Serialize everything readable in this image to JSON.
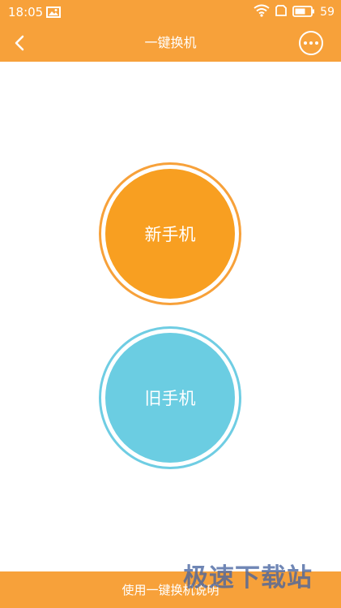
{
  "status_bar": {
    "time": "18:05",
    "battery": "59",
    "icons": [
      "gallery-icon",
      "wifi-icon",
      "sim-icon",
      "battery-icon"
    ]
  },
  "navbar": {
    "title": "一键换机",
    "back_icon": "back-arrow-icon",
    "more_icon": "more-icon"
  },
  "main": {
    "new_phone_label": "新手机",
    "old_phone_label": "旧手机"
  },
  "bottom_bar": {
    "label": "使用一键换机说明"
  },
  "watermark": {
    "text": "极速下载站"
  },
  "colors": {
    "accent_orange": "#F7A13A",
    "circle_orange": "#F89F21",
    "circle_blue": "#6BCDE2",
    "ring_blue": "#6FCDE3",
    "background": "#FFFFFF"
  }
}
